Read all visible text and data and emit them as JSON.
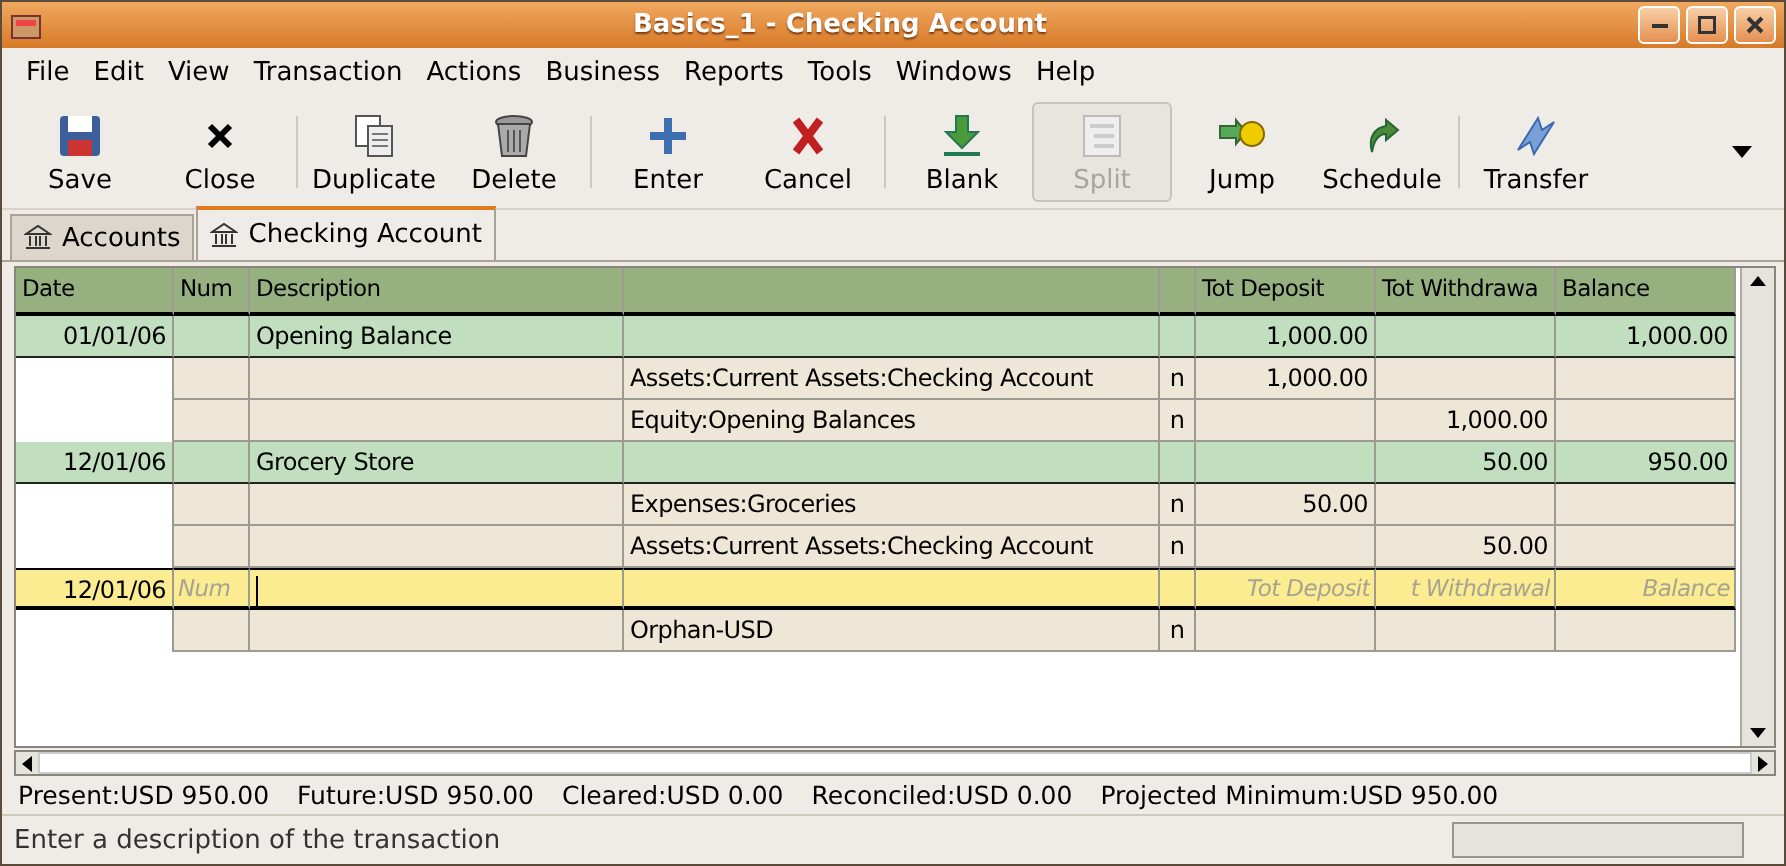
{
  "window": {
    "title": "Basics_1 - Checking Account"
  },
  "menu": [
    "File",
    "Edit",
    "View",
    "Transaction",
    "Actions",
    "Business",
    "Reports",
    "Tools",
    "Windows",
    "Help"
  ],
  "toolbar": [
    {
      "label": "Save",
      "disabled": false
    },
    {
      "label": "Close",
      "disabled": false
    },
    {
      "label": "Duplicate",
      "disabled": false
    },
    {
      "label": "Delete",
      "disabled": false
    },
    {
      "label": "Enter",
      "disabled": false
    },
    {
      "label": "Cancel",
      "disabled": false
    },
    {
      "label": "Blank",
      "disabled": false
    },
    {
      "label": "Split",
      "disabled": true
    },
    {
      "label": "Jump",
      "disabled": false
    },
    {
      "label": "Schedule",
      "disabled": false
    },
    {
      "label": "Transfer",
      "disabled": false
    }
  ],
  "tabs": [
    {
      "label": "Accounts",
      "selected": false
    },
    {
      "label": "Checking Account",
      "selected": true
    }
  ],
  "register": {
    "columns": [
      "Date",
      "Num",
      "Description",
      "",
      "",
      "Tot Deposit",
      "Tot Withdrawa",
      "Balance"
    ],
    "rows": [
      {
        "kind": "transaction",
        "cells": [
          "01/01/06",
          "",
          "Opening Balance",
          "",
          "",
          "1,000.00",
          "",
          "1,000.00"
        ]
      },
      {
        "kind": "split",
        "cells": [
          "",
          "",
          "",
          "Assets:Current Assets:Checking Account",
          "n",
          "1,000.00",
          "",
          ""
        ]
      },
      {
        "kind": "split",
        "cells": [
          "",
          "",
          "",
          "Equity:Opening Balances",
          "n",
          "",
          "1,000.00",
          ""
        ]
      },
      {
        "kind": "transaction",
        "cells": [
          "12/01/06",
          "",
          "Grocery Store",
          "",
          "",
          "",
          "50.00",
          "950.00"
        ]
      },
      {
        "kind": "split",
        "cells": [
          "",
          "",
          "",
          "Expenses:Groceries",
          "n",
          "50.00",
          "",
          ""
        ]
      },
      {
        "kind": "split",
        "cells": [
          "",
          "",
          "",
          "Assets:Current Assets:Checking Account",
          "n",
          "",
          "50.00",
          ""
        ]
      },
      {
        "kind": "entry",
        "date": "12/01/06",
        "num": {
          "placeholder": "Num"
        },
        "deposit": {
          "placeholder": "Tot Deposit"
        },
        "withdrawal": {
          "placeholder": "t Withdrawal"
        },
        "balance": {
          "placeholder": "Balance"
        }
      },
      {
        "kind": "split",
        "cells": [
          "",
          "",
          "",
          "Orphan-USD",
          "n",
          "",
          "",
          ""
        ]
      }
    ]
  },
  "summary": [
    "Present:USD 950.00",
    "Future:USD 950.00",
    "Cleared:USD 0.00",
    "Reconciled:USD 0.00",
    "Projected Minimum:USD 950.00"
  ],
  "status_bar": "Enter a description of the transaction",
  "progress": {
    "level": 0
  }
}
